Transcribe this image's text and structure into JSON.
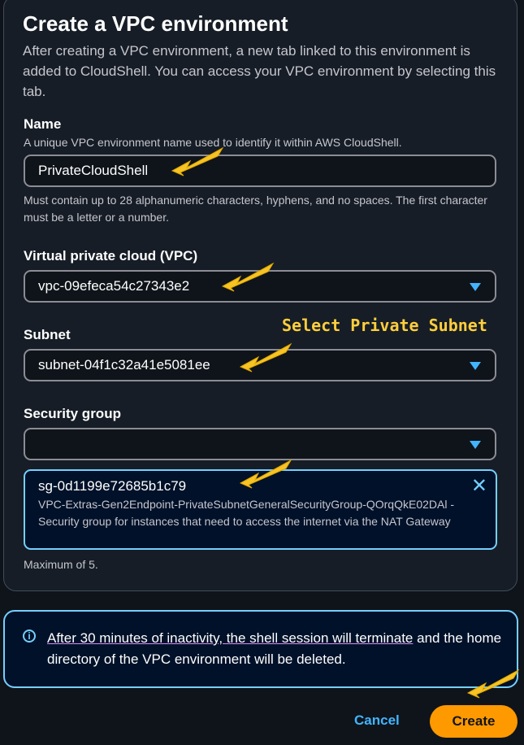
{
  "modal": {
    "title": "Create a VPC environment",
    "description": "After creating a VPC environment, a new tab linked to this environment is added to CloudShell. You can access your VPC environment by selecting this tab."
  },
  "name_field": {
    "label": "Name",
    "description": "A unique VPC environment name used to identify it within AWS CloudShell.",
    "value": "PrivateCloudShell",
    "constraint": "Must contain up to 28 alphanumeric characters, hyphens, and no spaces. The first character must be a letter or a number."
  },
  "vpc_field": {
    "label": "Virtual private cloud (VPC)",
    "value": "vpc-09efeca54c27343e2"
  },
  "subnet_field": {
    "label": "Subnet",
    "value": "subnet-04f1c32a41e5081ee"
  },
  "security_group": {
    "label": "Security group",
    "value": "",
    "selected": {
      "id": "sg-0d1199e72685b1c79",
      "description": "VPC-Extras-Gen2Endpoint-PrivateSubnetGeneralSecurityGroup-QOrqQkE02DAl - Security group for instances that need to access the internet via the NAT Gateway"
    },
    "max_note": "Maximum of 5."
  },
  "alert": {
    "underlined_text": "After 30 minutes of inactivity, the shell session will terminate",
    "rest_text": " and the home directory of the VPC environment will be deleted.",
    "icon": "info-icon"
  },
  "footer": {
    "cancel_label": "Cancel",
    "create_label": "Create"
  },
  "annotation": {
    "text": "Select Private Subnet",
    "color": "#ffce3d"
  },
  "colors": {
    "background": "#0f141a",
    "accent": "#42b4ff",
    "primary_button": "#ff9900"
  }
}
